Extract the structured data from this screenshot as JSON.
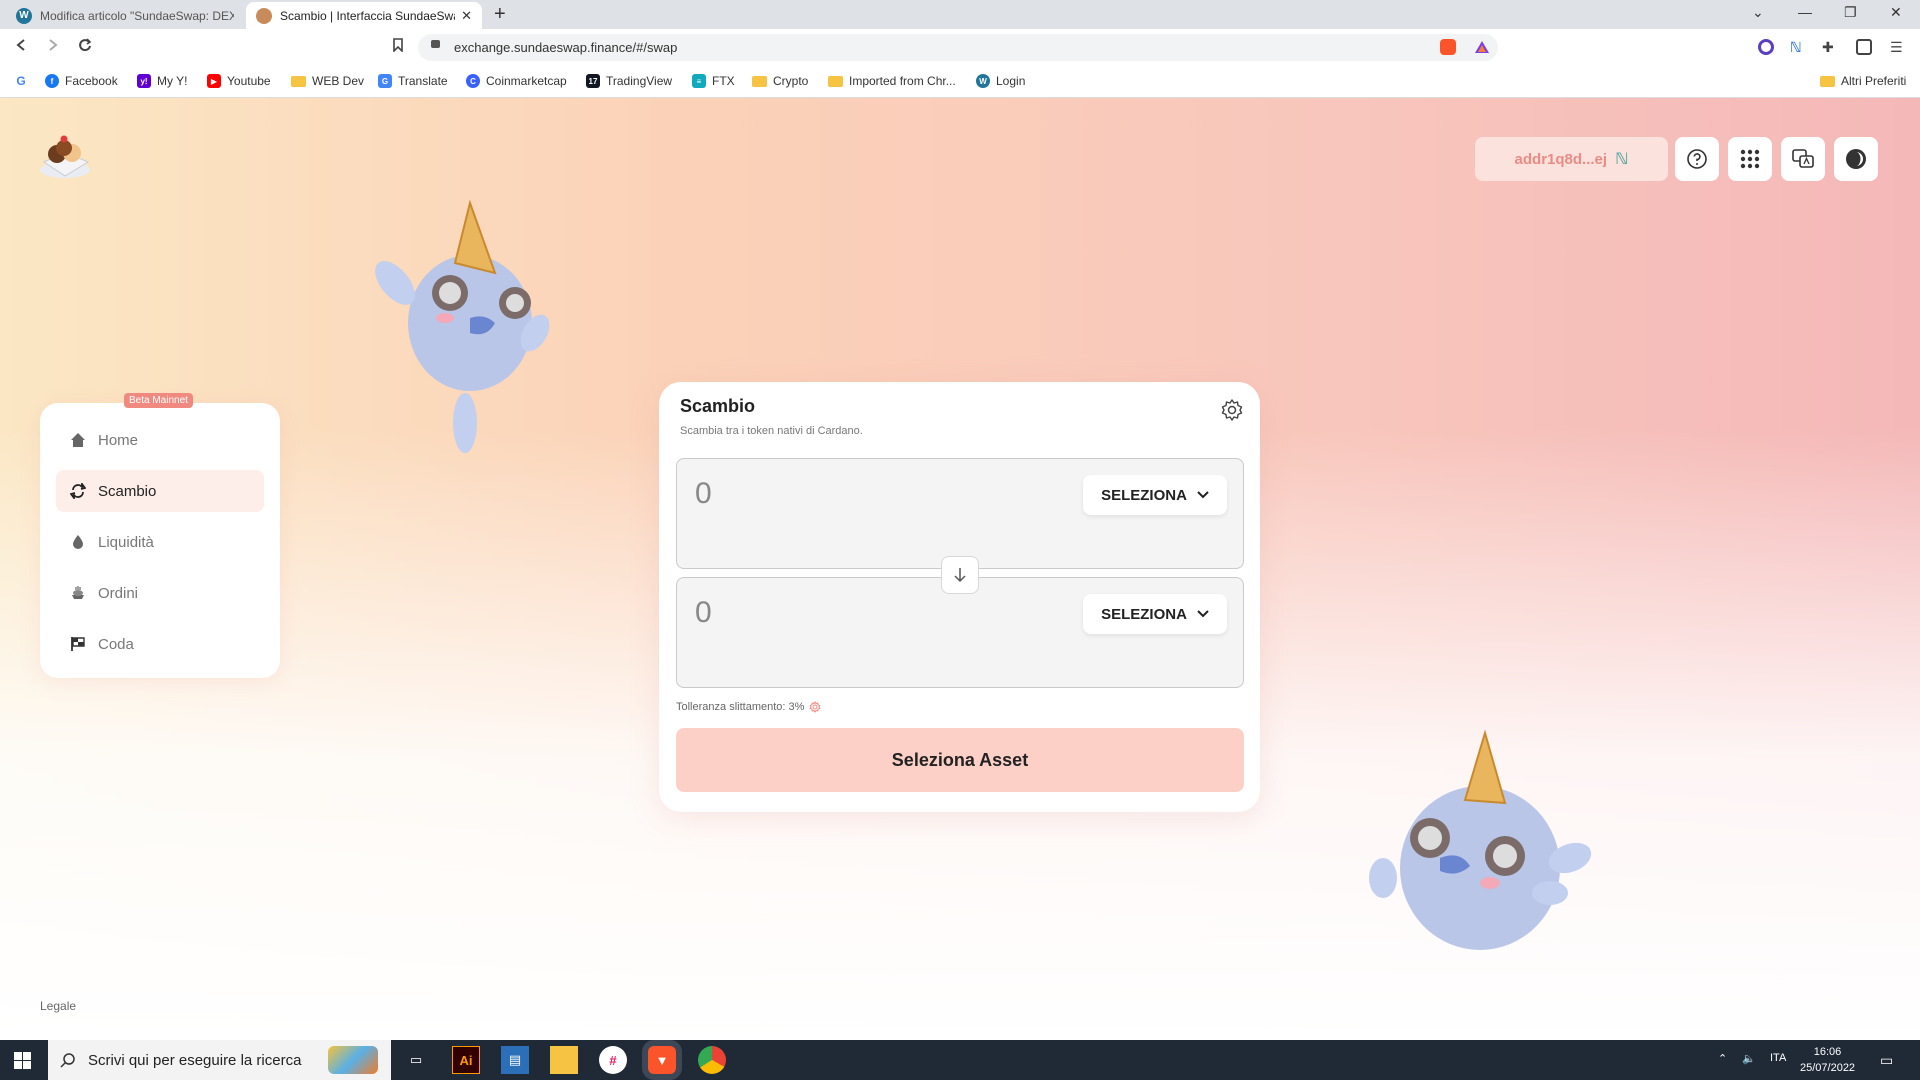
{
  "browser": {
    "tabs": [
      {
        "title": "Modifica articolo \"SundaeSwap: DEX s"
      },
      {
        "title": "Scambio | Interfaccia SundaeSwap"
      }
    ],
    "url": "exchange.sundaeswap.finance/#/swap",
    "bookmarks": [
      "Facebook",
      "My Y!",
      "Youtube",
      "WEB Dev",
      "Translate",
      "Coinmarketcap",
      "TradingView",
      "FTX",
      "Crypto",
      "Imported from Chr...",
      "Login"
    ],
    "other_bookmarks": "Altri Preferiti"
  },
  "header": {
    "wallet_address": "addr1q8d...ej"
  },
  "sidebar": {
    "badge": "Beta Mainnet",
    "items": [
      {
        "label": "Home"
      },
      {
        "label": "Scambio"
      },
      {
        "label": "Liquidità"
      },
      {
        "label": "Ordini"
      },
      {
        "label": "Coda"
      }
    ]
  },
  "swap": {
    "title": "Scambio",
    "subtitle": "Scambia tra i token nativi di Cardano.",
    "from_amount": "0",
    "to_amount": "0",
    "select_label": "SELEZIONA",
    "slippage": "Tolleranza slittamento: 3%",
    "cta": "Seleziona Asset"
  },
  "footer": {
    "legal": "Legale"
  },
  "taskbar": {
    "search_placeholder": "Scrivi qui per eseguire la ricerca",
    "language": "ITA",
    "time": "16:06",
    "date": "25/07/2022"
  },
  "colors": {
    "accent": "#f08a80",
    "cta_bg": "#fdd0c7",
    "wallet_text": "#ec8b86"
  }
}
